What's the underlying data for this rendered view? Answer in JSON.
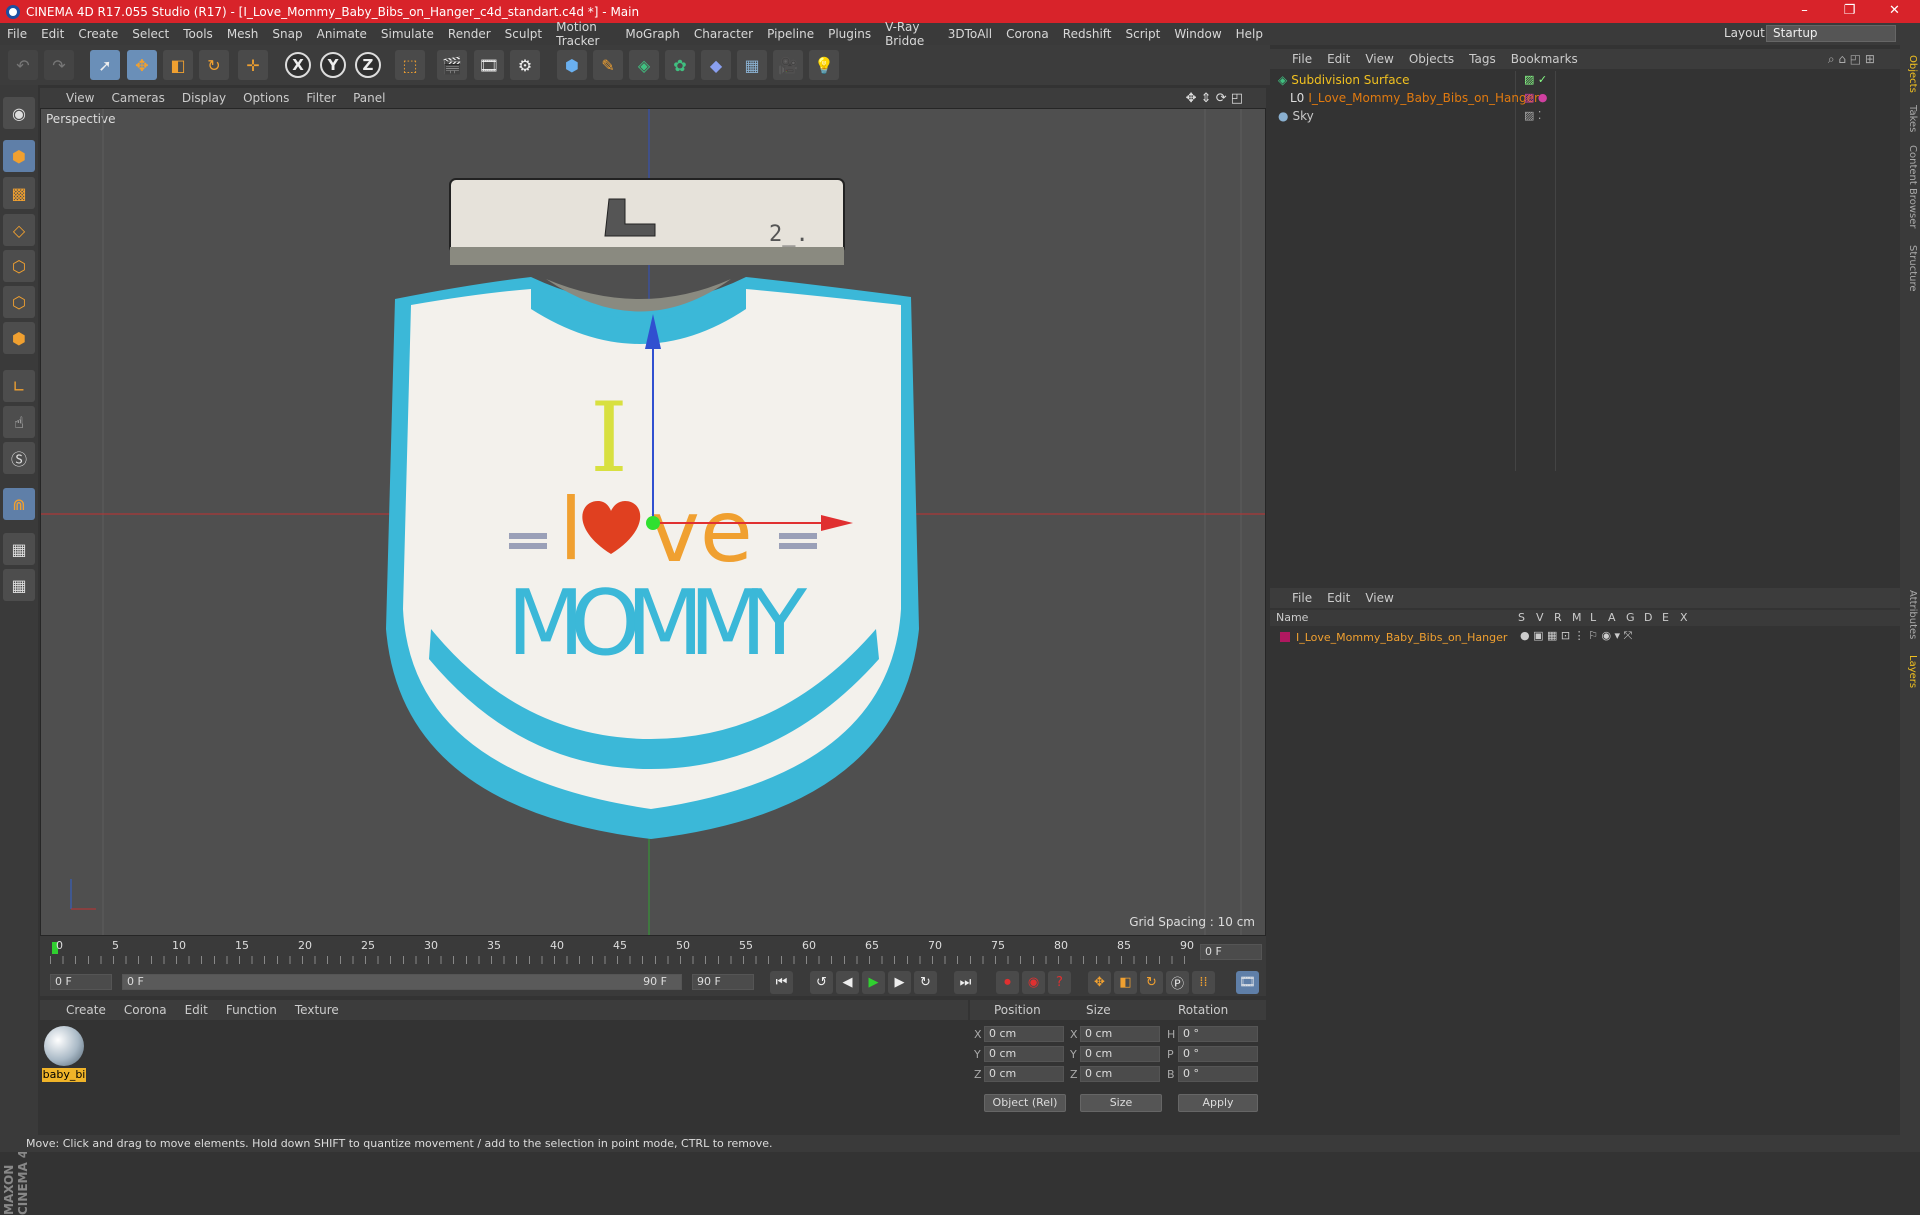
{
  "window": {
    "title": "CINEMA 4D R17.055 Studio (R17) - [I_Love_Mommy_Baby_Bibs_on_Hanger_c4d_standart.c4d *] - Main",
    "controls": {
      "minimize": "–",
      "maximize": "❐",
      "close": "✕"
    }
  },
  "menu": [
    "File",
    "Edit",
    "Create",
    "Select",
    "Tools",
    "Mesh",
    "Snap",
    "Animate",
    "Simulate",
    "Render",
    "Sculpt",
    "Motion Tracker",
    "MoGraph",
    "Character",
    "Pipeline",
    "Plugins",
    "V-Ray Bridge",
    "3DToAll",
    "Corona",
    "Redshift",
    "Script",
    "Window",
    "Help"
  ],
  "layout": {
    "label": "Layout:",
    "value": "Startup"
  },
  "toolbar": {
    "axis_x": "X",
    "axis_y": "Y",
    "axis_z": "Z"
  },
  "viewport": {
    "menu": [
      "View",
      "Cameras",
      "Display",
      "Options",
      "Filter",
      "Panel"
    ],
    "label": "Perspective",
    "grid_spacing": "Grid Spacing : 10 cm"
  },
  "timeline": {
    "ticks": [
      "0",
      "5",
      "10",
      "15",
      "20",
      "25",
      "30",
      "35",
      "40",
      "45",
      "50",
      "55",
      "60",
      "65",
      "70",
      "75",
      "80",
      "85",
      "90"
    ],
    "current_frame": "0 F"
  },
  "playback": {
    "start": "0 F",
    "range_start": "0 F",
    "range_end": "90 F",
    "end": "90 F"
  },
  "material_manager": {
    "menu": [
      "Create",
      "Corona",
      "Edit",
      "Function",
      "Texture"
    ],
    "material_name": "baby_bi"
  },
  "coordinates": {
    "headers": {
      "position": "Position",
      "size": "Size",
      "rotation": "Rotation"
    },
    "rows": [
      {
        "axis": "X",
        "pos": "0 cm",
        "size_axis": "X",
        "size": "0 cm",
        "rot_axis": "H",
        "rot": "0 °"
      },
      {
        "axis": "Y",
        "pos": "0 cm",
        "size_axis": "Y",
        "size": "0 cm",
        "rot_axis": "P",
        "rot": "0 °"
      },
      {
        "axis": "Z",
        "pos": "0 cm",
        "size_axis": "Z",
        "size": "0 cm",
        "rot_axis": "B",
        "rot": "0 °"
      }
    ],
    "mode": "Object (Rel)",
    "size_mode": "Size",
    "apply": "Apply"
  },
  "object_manager": {
    "menu": [
      "File",
      "Edit",
      "View",
      "Objects",
      "Tags",
      "Bookmarks"
    ],
    "objects": [
      {
        "name": "Subdivision Surface",
        "color": "#f0c020"
      },
      {
        "name": "I_Love_Mommy_Baby_Bibs_on_Hanger",
        "color": "#e07a10"
      },
      {
        "name": "Sky",
        "color": "#c8c8c8"
      }
    ]
  },
  "layer_manager": {
    "menu": [
      "File",
      "Edit",
      "View"
    ],
    "columns": [
      "Name",
      "S",
      "V",
      "R",
      "M",
      "L",
      "A",
      "G",
      "D",
      "E",
      "X"
    ],
    "layer_name": "I_Love_Mommy_Baby_Bibs_on_Hanger"
  },
  "side_tabs": [
    "Objects",
    "Takes",
    "Content Browser",
    "Structure",
    "Attributes",
    "Layers"
  ],
  "status": "Move: Click and drag to move elements. Hold down SHIFT to quantize movement / add to the selection in point mode, CTRL to remove.",
  "logo": "MAXON CINEMA 4D",
  "bib": {
    "line1": "I",
    "line2_pre": "l",
    "line2_post": "ve",
    "line3": "MOMMY"
  },
  "colors": {
    "accent_red": "#d8232a",
    "bib_trim": "#3bb8d8",
    "heart": "#e04020",
    "letter_i": "#d8e040",
    "letter_love": "#f0a030",
    "mommy": "#3bb8d8"
  }
}
